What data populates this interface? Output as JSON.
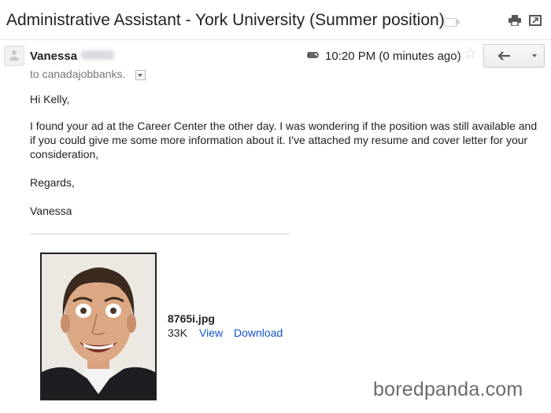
{
  "email": {
    "subject": "Administrative Assistant - York University (Summer position)",
    "sender_name": "Vanessa",
    "recipient_line": "to canadajobbanks.",
    "timestamp": "10:20 PM (0 minutes ago)",
    "body": {
      "greeting": "Hi Kelly,",
      "paragraph": "I found your ad at the Career Center the other day. I was wondering if the position was still available and if you could give me some more information about it. I've attached my resume and cover letter for your consideration,",
      "closing": "Regards,",
      "signature": "Vanessa"
    }
  },
  "attachment": {
    "file_name": "8765i.jpg",
    "size": "33K",
    "view_label": "View",
    "download_label": "Download"
  },
  "watermark": "boredpanda.com",
  "icons": {
    "label": "label-icon",
    "print": "print-icon",
    "new_window": "new-window-icon",
    "attachment": "paperclip-icon",
    "star": "star-icon",
    "reply": "reply-icon",
    "more": "chevron-down-icon"
  },
  "colors": {
    "link": "#1155cc",
    "text": "#222222",
    "muted": "#777777"
  }
}
